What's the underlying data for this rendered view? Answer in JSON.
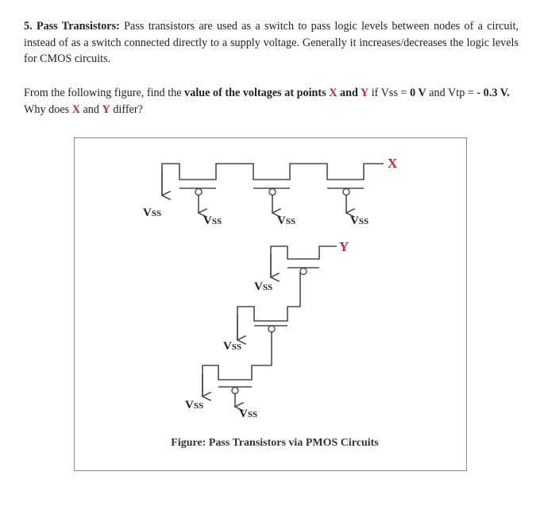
{
  "question": {
    "number_title": "5. Pass Transistors:",
    "intro": "Pass transistors are used as a switch to pass logic levels between nodes of a circuit, instead of as a switch connected directly to a supply voltage. Generally it increases/decreases the logic levels for CMOS circuits.",
    "prompt_part1": "From the following figure, find the ",
    "prompt_bold": "value of the voltages at points ",
    "x_label": "X",
    "and_bold": " and ",
    "y_label": "Y",
    "prompt_part2": " if  Vss = ",
    "vss_value": "0 V",
    "prompt_part3": " and Vtp = ",
    "vtp_value": "- 0.3 V.",
    "prompt_part4": " Why does ",
    "x_label2": "X",
    "and_plain": " and ",
    "y_label2": "Y",
    "prompt_part5": " differ?"
  },
  "figure": {
    "vss_main": "V",
    "vss_sub": "SS",
    "node_x": "X",
    "node_y": "Y",
    "caption": "Figure: Pass Transistors via PMOS Circuits"
  },
  "colors": {
    "accent_red": "#d0262b",
    "wire": "#4a4a4a",
    "frame": "#8a8a96"
  }
}
